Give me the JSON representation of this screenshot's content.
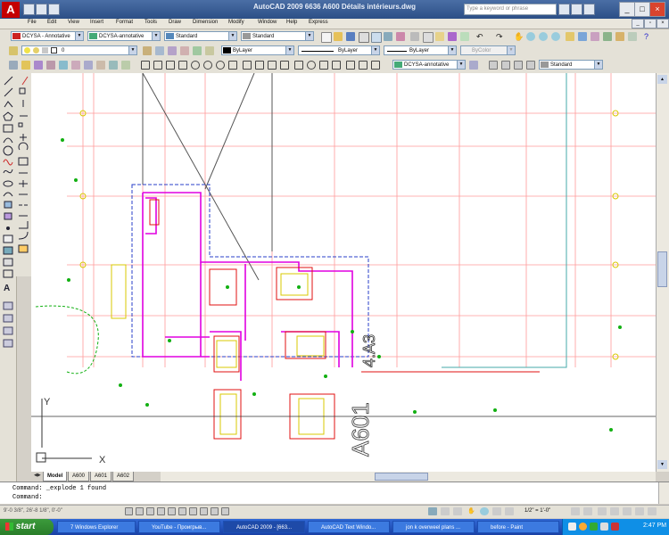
{
  "window": {
    "app_title": "AutoCAD 2009 6636 A600 Détails intérieurs.dwg",
    "search_placeholder": "Type a keyword or phrase",
    "minimize": "_",
    "maximize": "□",
    "close": "×"
  },
  "menu": [
    "File",
    "Edit",
    "View",
    "Insert",
    "Format",
    "Tools",
    "Draw",
    "Dimension",
    "Modify",
    "Window",
    "Help",
    "Express"
  ],
  "toolbar1": {
    "text_style": "DCYSA - Annotative",
    "dim_style": "DCYSA-annotative",
    "table_style": "Standard",
    "mleader_style": "Standard"
  },
  "toolbar2": {
    "layer": "0",
    "color": "ByLayer",
    "linetype": "ByLayer",
    "lineweight": "ByLayer",
    "plotstyle": "ByColor"
  },
  "toolbar3": {
    "dim_style": "DCYSA-annotative",
    "style": "Standard"
  },
  "drawing": {
    "view_label_a601": "A601",
    "view_label_a4": "4.A3",
    "axis_x": "X",
    "axis_y": "Y"
  },
  "layout_tabs": [
    "Model",
    "A600",
    "A601",
    "A602"
  ],
  "command": {
    "line1": "Command:  _explode 1 found",
    "line2": "Command:"
  },
  "status": {
    "coords": "9'-0 3/8\", 26'-8 1/8\", 0'-0\"",
    "scale": "1/2\" = 1'-0\""
  },
  "taskbar": {
    "start": "start",
    "tasks": [
      "7 Windows Explorer",
      "YouTube - Проигрыв...",
      "AutoCAD 2009 - [663...",
      "AutoCAD Text Windo...",
      "jon k overweel plans ...",
      "before - Paint"
    ],
    "clock": "2:47 PM"
  },
  "colors": {
    "accent": "#2c4f86",
    "drawing_bg": "#ffffff",
    "grid": "#ff8080",
    "layout": "#ff00ff"
  }
}
